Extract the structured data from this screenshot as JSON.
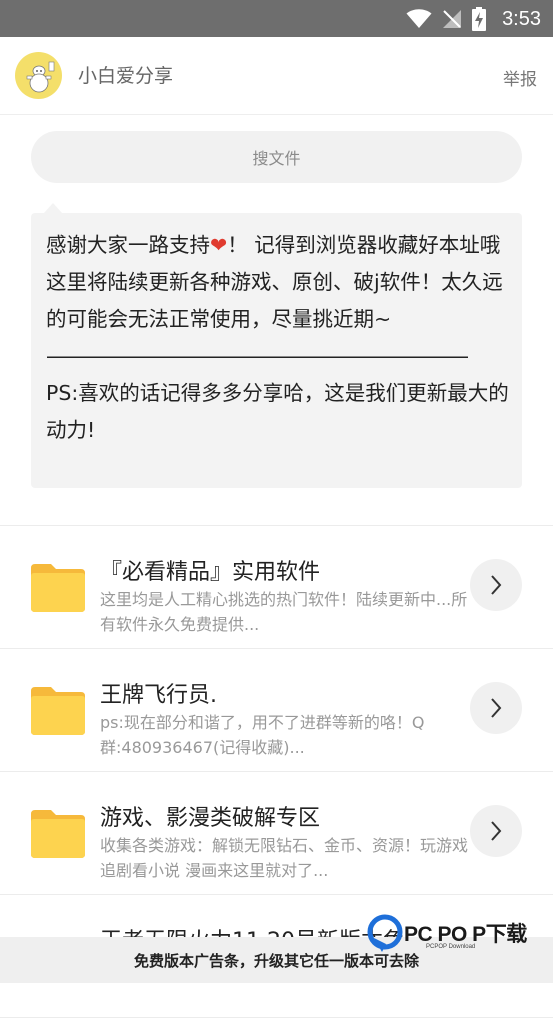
{
  "status_bar": {
    "time": "3:53"
  },
  "header": {
    "shop_name": "小白爱分享",
    "report_label": "举报"
  },
  "search": {
    "placeholder": "搜文件"
  },
  "notice": {
    "line1_before": "感谢大家一路支持",
    "heart": "❤",
    "line1_after": "！ 记得到浏览器收藏好本址哦 这里将陆续更新各种游戏、原创、破j软件！太久远的可能会无法正常使用，尽量挑近期~",
    "separator": "————————————————————————",
    "ps": "PS:喜欢的话记得多多分享哈，这是我们更新最大的动力!"
  },
  "items": [
    {
      "title": "『必看精品』实用软件",
      "desc": "这里均是人工精心挑选的热门软件！陆续更新中...所有软件永久免费提供..."
    },
    {
      "title": "王牌飞行员.",
      "desc": "ps:现在部分和谐了，用不了进群等新的咯！Q群:480936467(记得收藏)..."
    },
    {
      "title": "游戏、影漫类破解专区",
      "desc": "收集各类游戏：解锁无限钻石、金币、资源！玩游戏 追剧看小说 漫画来这里就对了..."
    },
    {
      "title": "王者无限火力11.20号新版本免",
      "desc": ""
    }
  ],
  "ad_banner": {
    "text": "免费版本广告条，升级其它任一版本可去除"
  },
  "watermark": {
    "text": "PC PO P下载",
    "sub": "PCPOP Download"
  },
  "colors": {
    "folder": "#fdd34f",
    "status_bar": "#6e6e6e",
    "heart": "#e03b2f"
  },
  "icons": {
    "wifi": "wifi-icon",
    "signal": "no-signal-icon",
    "battery": "battery-charging-icon",
    "chevron": "chevron-right-icon",
    "folder": "folder-icon"
  }
}
